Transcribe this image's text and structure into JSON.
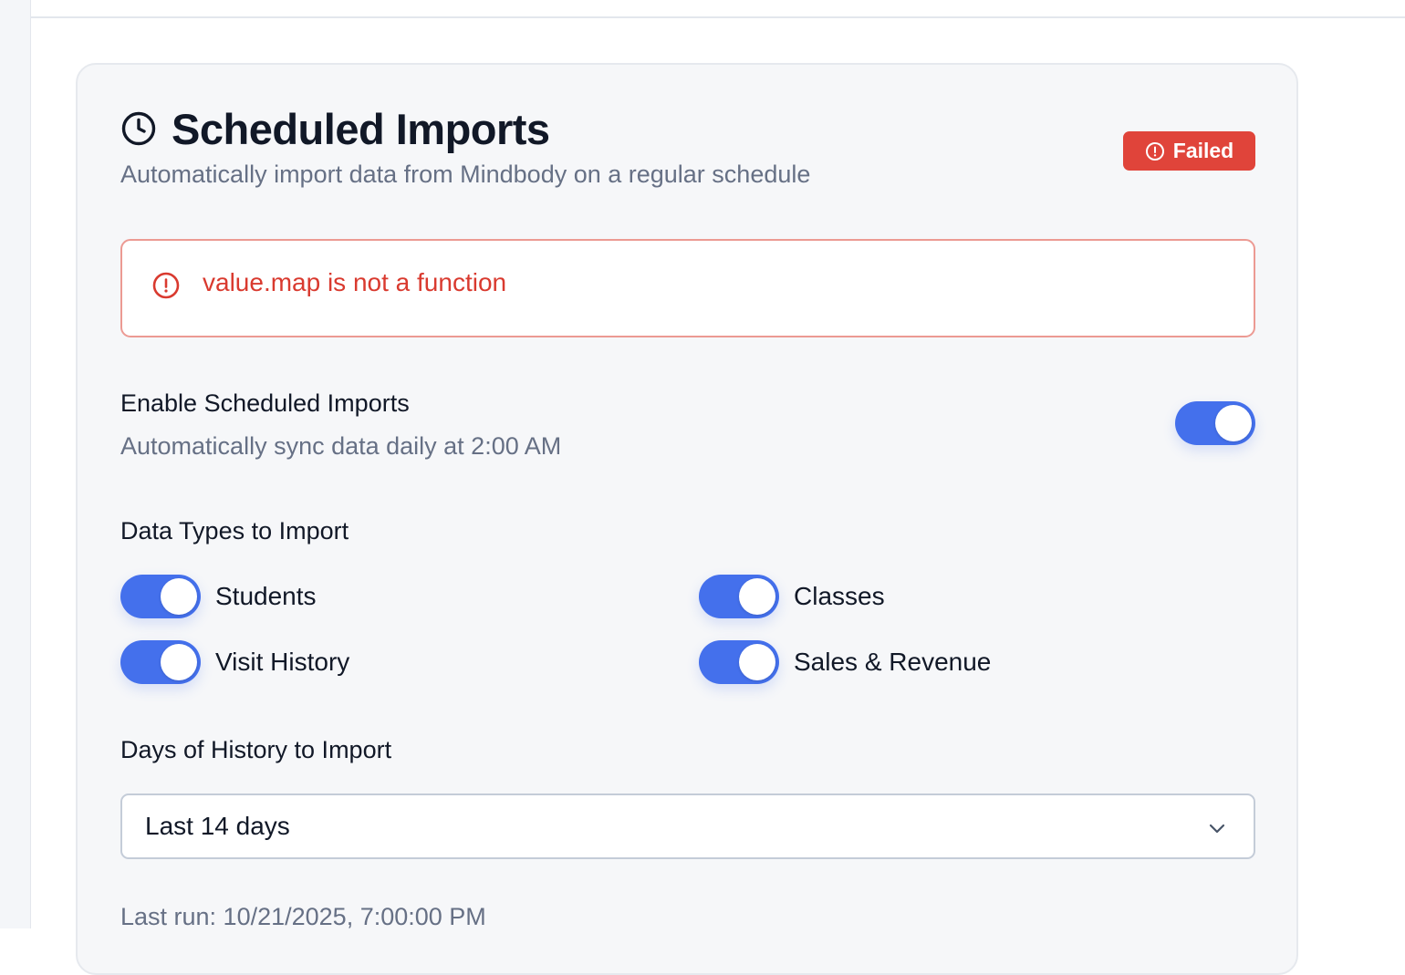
{
  "header": {
    "title": "Scheduled Imports",
    "subtitle": "Automatically import data from Mindbody on a regular schedule",
    "status_badge": "Failed"
  },
  "error": {
    "message": "value.map is not a function"
  },
  "schedule": {
    "label": "Enable Scheduled Imports",
    "description": "Automatically sync data daily at 2:00 AM",
    "enabled": true
  },
  "data_types": {
    "label": "Data Types to Import",
    "items": [
      {
        "label": "Students",
        "enabled": true
      },
      {
        "label": "Classes",
        "enabled": true
      },
      {
        "label": "Visit History",
        "enabled": true
      },
      {
        "label": "Sales & Revenue",
        "enabled": true
      }
    ]
  },
  "history": {
    "label": "Days of History to Import",
    "selected": "Last 14 days"
  },
  "last_run": "Last run: 10/21/2025, 7:00:00 PM",
  "colors": {
    "accent": "#4470ec",
    "error": "#e0443a",
    "error_text": "#d93a2f",
    "error_border": "#ec9a93",
    "muted_text": "#667085",
    "card_bg": "#f6f7f9"
  },
  "icons": {
    "title": "clock-icon",
    "badge": "alert-circle-icon",
    "error": "alert-circle-icon",
    "select": "chevron-down-icon"
  }
}
